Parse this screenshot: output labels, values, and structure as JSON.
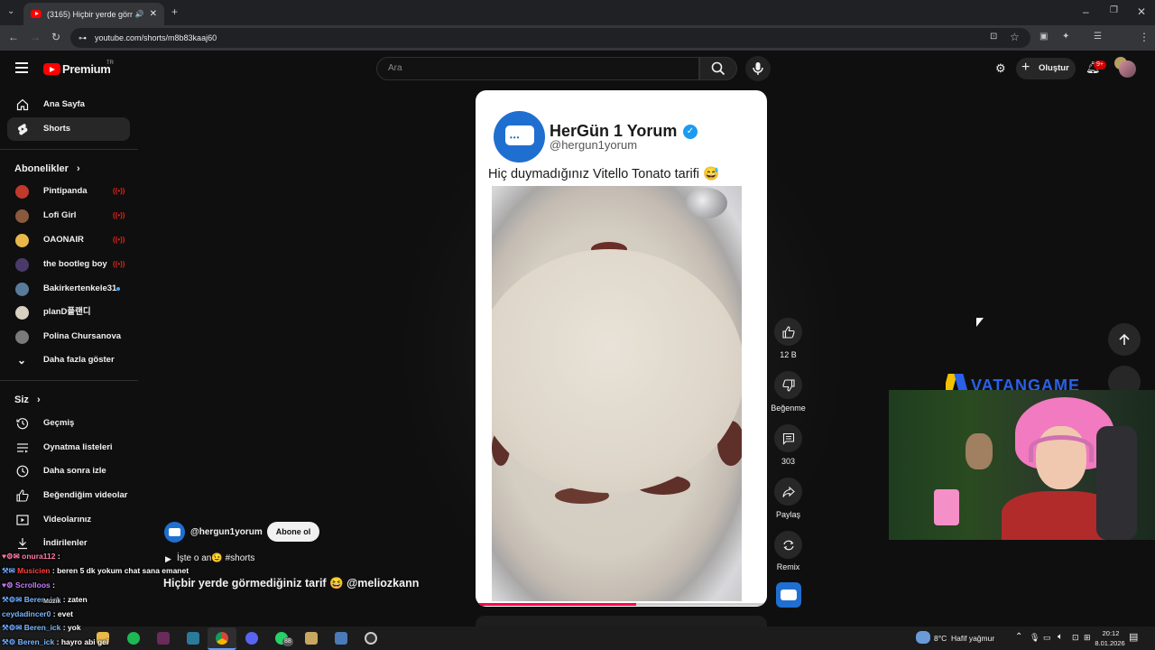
{
  "browser": {
    "tab_title": "(3165) Hiçbir yerde görmed",
    "url": "youtube.com/shorts/m8b83kaaj60"
  },
  "header": {
    "logo_text": "Premium",
    "logo_region": "TR",
    "search_placeholder": "Ara",
    "create_label": "Oluştur",
    "notification_badge": "9+"
  },
  "sidebar": {
    "main": [
      {
        "label": "Ana Sayfa",
        "icon": "home-icon"
      },
      {
        "label": "Shorts",
        "icon": "shorts-icon"
      }
    ],
    "subscriptions_title": "Abonelikler",
    "subscriptions": [
      {
        "label": "Pintipanda",
        "status": "live",
        "color": "#c0392b"
      },
      {
        "label": "Lofi Girl",
        "status": "live",
        "color": "#8b5a3c"
      },
      {
        "label": "OAONAIR",
        "status": "live",
        "color": "#e8b84a"
      },
      {
        "label": "the bootleg boy",
        "status": "live",
        "color": "#4a3a6a"
      },
      {
        "label": "Bakirkertenkele31",
        "status": "new",
        "color": "#5a7a9a"
      },
      {
        "label": "planD플랜디",
        "status": "",
        "color": "#d8d0c0"
      },
      {
        "label": "Polina Chursanova",
        "status": "",
        "color": "#7a7a7a"
      }
    ],
    "show_more": "Daha fazla göster",
    "you_title": "Siz",
    "you_items": [
      {
        "label": "Geçmiş",
        "icon": "history-icon"
      },
      {
        "label": "Oynatma listeleri",
        "icon": "playlist-icon"
      },
      {
        "label": "Daha sonra izle",
        "icon": "clock-icon"
      },
      {
        "label": "Beğendiğim videolar",
        "icon": "like-icon"
      },
      {
        "label": "Videolarınız",
        "icon": "video-icon"
      },
      {
        "label": "İndirilenler",
        "icon": "download-icon"
      }
    ]
  },
  "short": {
    "channel_name": "HerGün 1 Yorum",
    "channel_handle": "@hergun1yorum",
    "caption": "Hiç duymadığınız Vitello Tonato tarifi 😅",
    "likes": "12 B",
    "dislike_label": "Beğenme",
    "comments": "303",
    "share_label": "Paylaş",
    "remix_label": "Remix",
    "progress": 0.55
  },
  "meta": {
    "channel": "@hergun1yorum",
    "subscribe_label": "Abone ol",
    "description": "İşte o an😉 #shorts",
    "title": "Hiçbir yerde görmediğiniz tarif 😆 @meliozkann"
  },
  "chat": [
    {
      "user": "onura112",
      "text": ":",
      "color": "#ff7aa8"
    },
    {
      "user": "Musicien",
      "text": ": beren 5 dk yokum chat sana emanet",
      "color": "#ff4040"
    },
    {
      "user": "Scrolloos",
      "text": ":",
      "color": "#c87aff"
    },
    {
      "user": "Beren_ick",
      "text": ": zaten",
      "color": "#7ab8ff"
    },
    {
      "user": "ceydadincer0",
      "text": ": evet",
      "color": "#7ab8ff"
    },
    {
      "user": "Beren_ick",
      "text": ": yok",
      "color": "#7ab8ff"
    },
    {
      "user": "Beren_ick",
      "text": ": hayro abi gel",
      "color": "#7ab8ff"
    }
  ],
  "chat_overlay_text": "Müzik",
  "webcam": {
    "banner_text": "VATANGAME"
  },
  "taskbar": {
    "weather": "8°C  Hafif yağmur",
    "time": "20:12",
    "date": "8.01.2026",
    "whatsapp_badge": "88"
  }
}
